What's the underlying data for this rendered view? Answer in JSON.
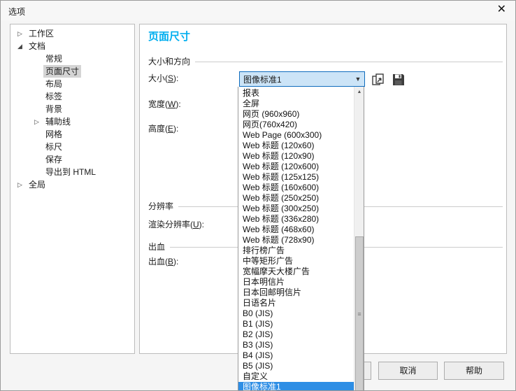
{
  "window": {
    "title": "选项"
  },
  "icons": {
    "close": "✕",
    "collapsed": "▷",
    "expanded": "◢",
    "dropdown_arrow": "▼",
    "scroll_up": "▲",
    "thumb_grip": "≡"
  },
  "tree": {
    "items": [
      {
        "key": "workspace",
        "label": "工作区",
        "level": 0,
        "state": "collapsed"
      },
      {
        "key": "document",
        "label": "文档",
        "level": 0,
        "state": "expanded"
      },
      {
        "key": "general",
        "label": "常规",
        "level": 1
      },
      {
        "key": "page-size",
        "label": "页面尺寸",
        "level": 1,
        "selected": true
      },
      {
        "key": "layout",
        "label": "布局",
        "level": 1
      },
      {
        "key": "label",
        "label": "标签",
        "level": 1
      },
      {
        "key": "background",
        "label": "背景",
        "level": 1
      },
      {
        "key": "guidelines",
        "label": "辅助线",
        "level": 1,
        "state": "collapsed"
      },
      {
        "key": "grid",
        "label": "网格",
        "level": 1
      },
      {
        "key": "rulers",
        "label": "标尺",
        "level": 1
      },
      {
        "key": "save",
        "label": "保存",
        "level": 1
      },
      {
        "key": "export-html",
        "label": "导出到 HTML",
        "level": 1
      },
      {
        "key": "global",
        "label": "全局",
        "level": 0,
        "state": "collapsed"
      }
    ]
  },
  "panel": {
    "title": "页面尺寸",
    "title_color": "#00aeef",
    "groups": {
      "size_orientation": "大小和方向",
      "resolution": "分辨率",
      "bleed": "出血"
    },
    "fields": {
      "size_label": "大小(S):",
      "size_value": "图像标准1",
      "width_label": "宽度(W):",
      "height_label": "高度(E):",
      "render_resolution_label": "渲染分辨率(U):",
      "bleed_label": "出血(B):"
    },
    "toolbar": {
      "page_from_printer_icon": "page-from-printer-icon",
      "save_icon": "save-preset-icon",
      "delete_icon": "delete-preset-icon"
    }
  },
  "dropdown": {
    "highlight_color": "#2e8ee5",
    "highlighted_item": "图像标准1",
    "items": [
      "报表",
      "全屏",
      "网页 (960x960)",
      "网页(760x420)",
      "Web Page (600x300)",
      "Web 标题 (120x60)",
      "Web 标题 (120x90)",
      "Web 标题 (120x600)",
      "Web 标题 (125x125)",
      "Web 标题 (160x600)",
      "Web 标题 (250x250)",
      "Web 标题 (300x250)",
      "Web 标题 (336x280)",
      "Web 标题 (468x60)",
      "Web 标题 (728x90)",
      "排行榜广告",
      "中等矩形广告",
      "宽幅摩天大楼广告",
      "日本明信片",
      "日本回邮明信片",
      "日语名片",
      "B0 (JIS)",
      "B1 (JIS)",
      "B2 (JIS)",
      "B3 (JIS)",
      "B4 (JIS)",
      "B5 (JIS)",
      "自定义",
      "图像标准1"
    ]
  },
  "buttons": {
    "cancel": "取消",
    "help": "帮助"
  }
}
